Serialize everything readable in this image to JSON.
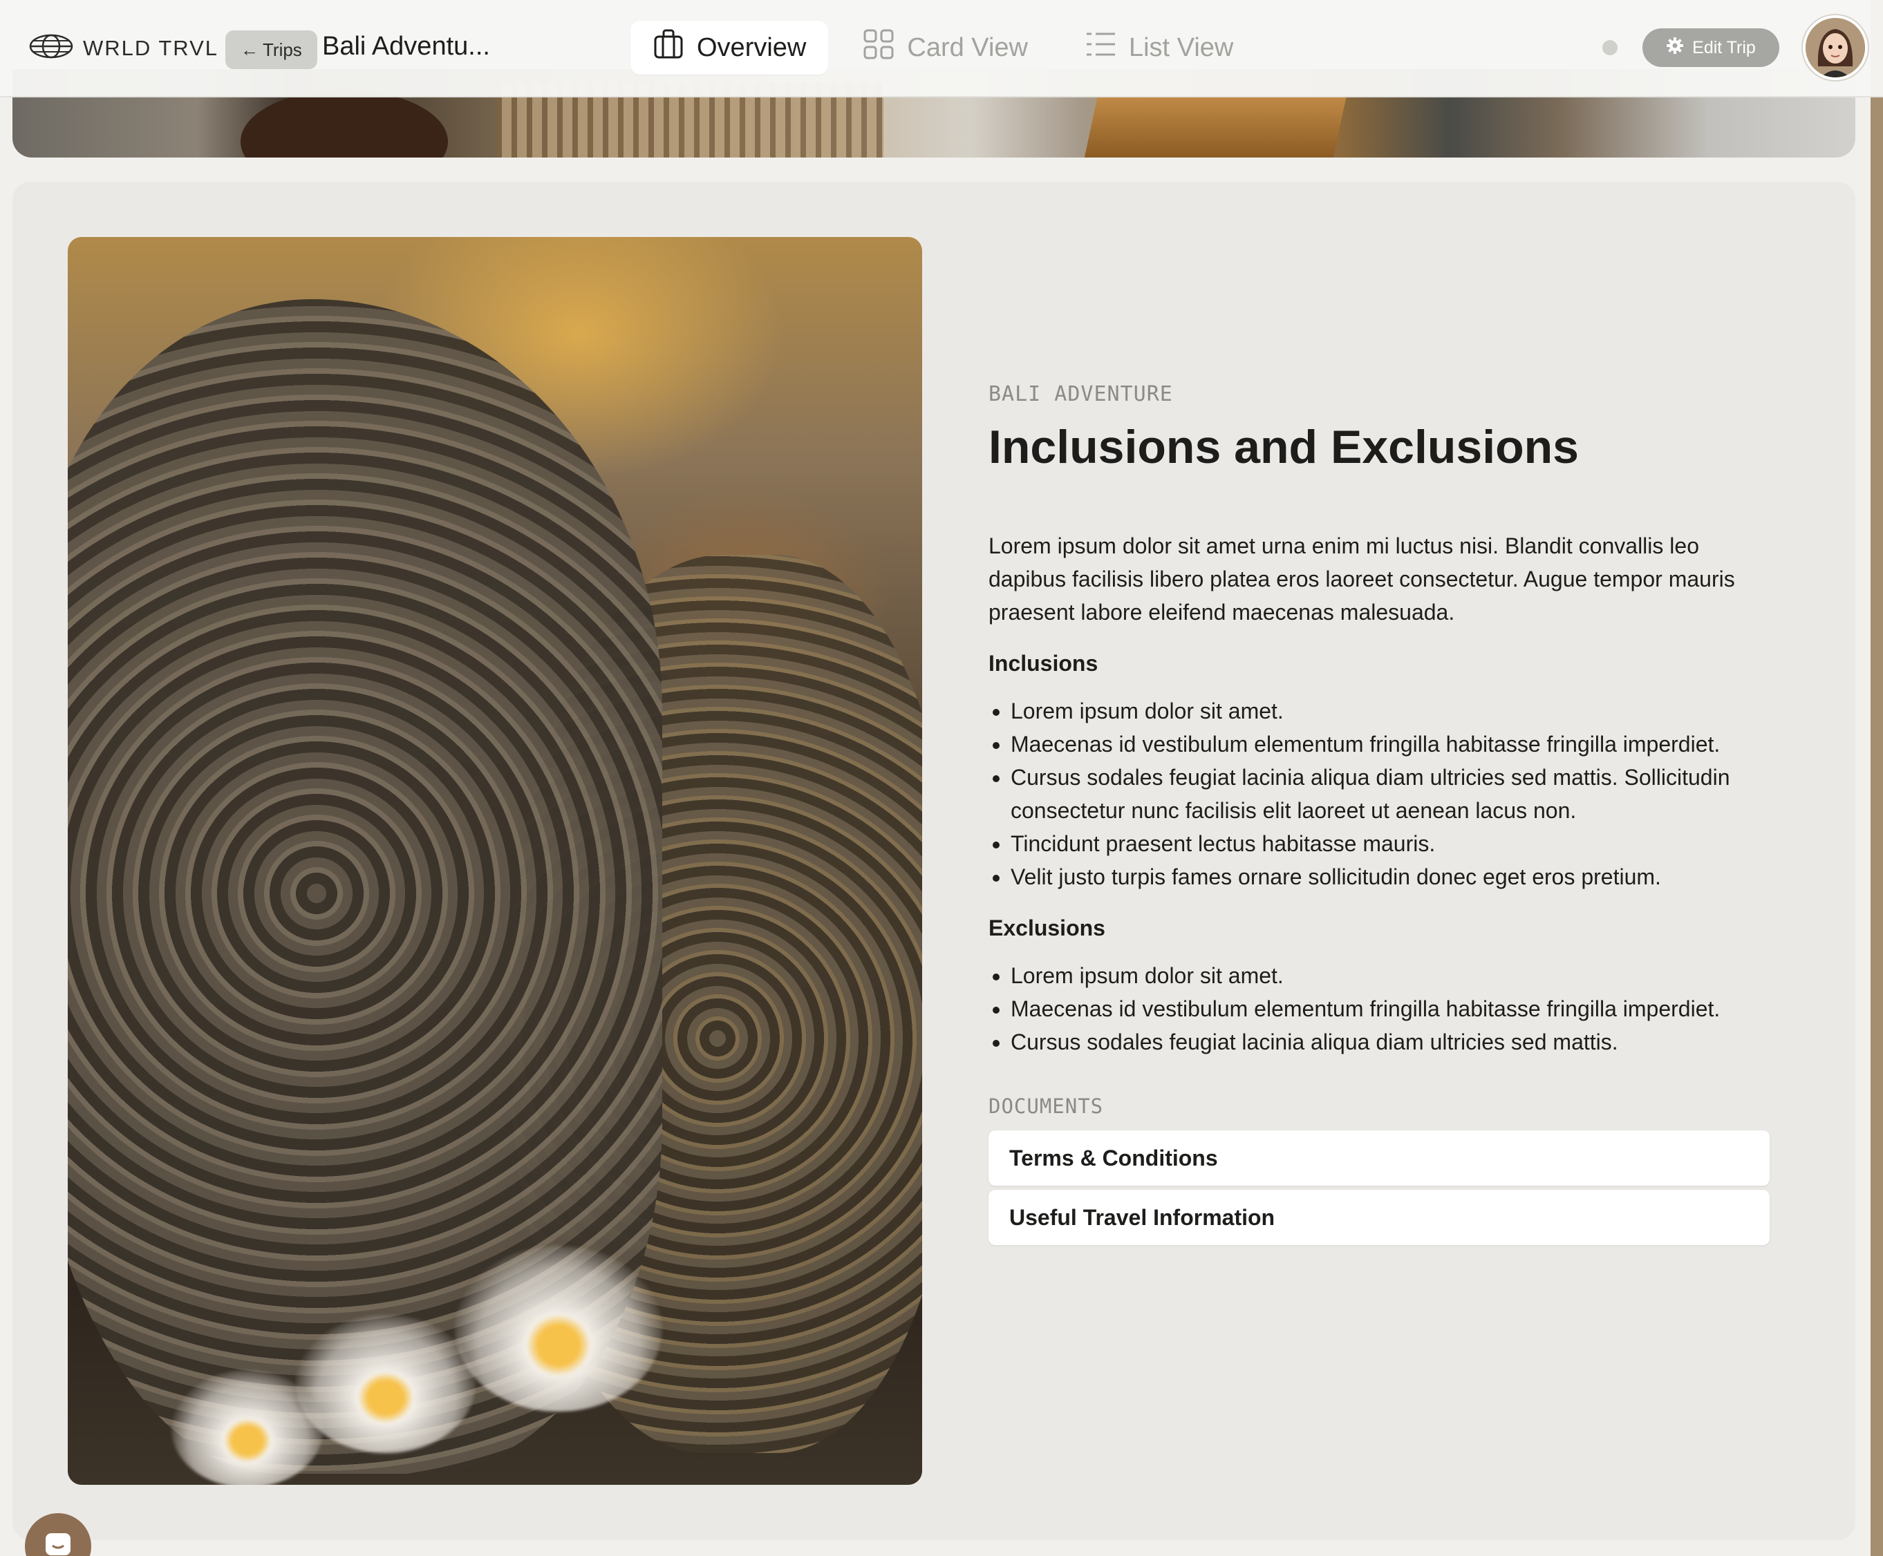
{
  "brand": {
    "name": "WRLD TRVL",
    "icon": "globe-icon"
  },
  "nav": {
    "back_label": "Trips",
    "trip_title": "Bali Adventu...",
    "tabs": [
      {
        "label": "Overview",
        "icon": "suitcase-icon",
        "active": true
      },
      {
        "label": "Card View",
        "icon": "grid-icon",
        "active": false
      },
      {
        "label": "List View",
        "icon": "list-icon",
        "active": false
      }
    ],
    "edit_label": "Edit Trip"
  },
  "section": {
    "eyebrow": "BALI ADVENTURE",
    "heading": "Inclusions and Exclusions",
    "intro": "Lorem ipsum dolor sit amet urna enim mi luctus nisi. Blandit convallis leo dapibus facilisis libero platea eros laoreet consectetur. Augue tempor mauris praesent labore eleifend maecenas malesuada.",
    "inclusions_title": "Inclusions",
    "inclusions": [
      "Lorem ipsum dolor sit amet.",
      "Maecenas id vestibulum elementum fringilla habitasse fringilla imperdiet.",
      "Cursus sodales feugiat lacinia aliqua diam ultricies sed mattis. Sollicitudin consectetur nunc facilisis elit laoreet ut aenean lacus non.",
      "Tincidunt praesent lectus habitasse mauris.",
      "Velit justo turpis fames ornare sollicitudin donec eget eros pretium."
    ],
    "exclusions_title": "Exclusions",
    "exclusions": [
      "Lorem ipsum dolor sit amet.",
      "Maecenas id vestibulum elementum fringilla habitasse fringilla imperdiet.",
      "Cursus sodales feugiat lacinia aliqua diam ultricies sed mattis."
    ],
    "documents_label": "DOCUMENTS",
    "documents": [
      "Terms & Conditions",
      "Useful Travel Information"
    ]
  },
  "colors": {
    "accent": "#a58d6f",
    "card_bg": "#ebe9e5",
    "page_bg": "#f1f0ec"
  }
}
